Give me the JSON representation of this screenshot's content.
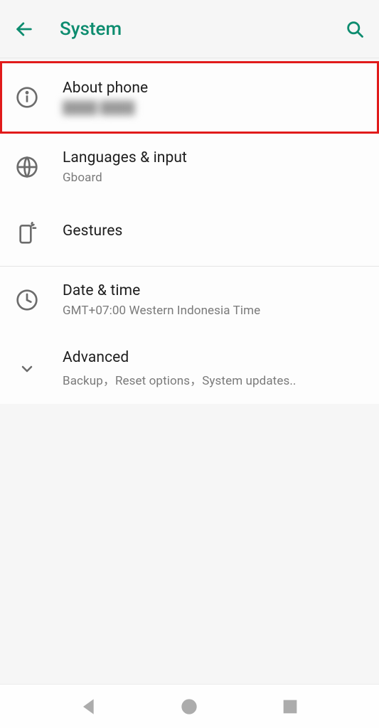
{
  "header": {
    "title": "System"
  },
  "items": {
    "about_phone": {
      "title": "About phone",
      "subtitle": "████ ████"
    },
    "languages_input": {
      "title": "Languages & input",
      "subtitle": "Gboard"
    },
    "gestures": {
      "title": "Gestures"
    },
    "date_time": {
      "title": "Date & time",
      "subtitle": "GMT+07:00 Western Indonesia Time"
    },
    "advanced": {
      "title": "Advanced",
      "subtitle": "Backup，Reset options，System updates.."
    }
  }
}
